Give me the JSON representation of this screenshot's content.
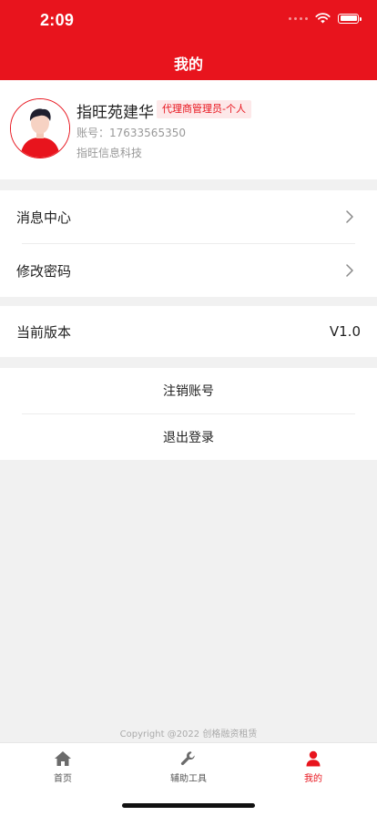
{
  "status": {
    "time": "2:09"
  },
  "header": {
    "title": "我的"
  },
  "profile": {
    "name": "指旺苑建华",
    "role": "代理商管理员-个人",
    "account": "账号：17633565350",
    "company": "指旺信息科技"
  },
  "menu": {
    "messages": "消息中心",
    "change_password": "修改密码",
    "version_label": "当前版本",
    "version_value": "V1.0",
    "cancel_account": "注销账号",
    "logout": "退出登录"
  },
  "footer": {
    "copyright": "Copyright @2022 创格融资租赁"
  },
  "tabs": [
    {
      "label": "首页",
      "icon": "home-icon"
    },
    {
      "label": "辅助工具",
      "icon": "wrench-icon"
    },
    {
      "label": "我的",
      "icon": "person-icon",
      "active": true
    }
  ],
  "colors": {
    "brand": "#e8141d",
    "background": "#f1f1f1"
  }
}
